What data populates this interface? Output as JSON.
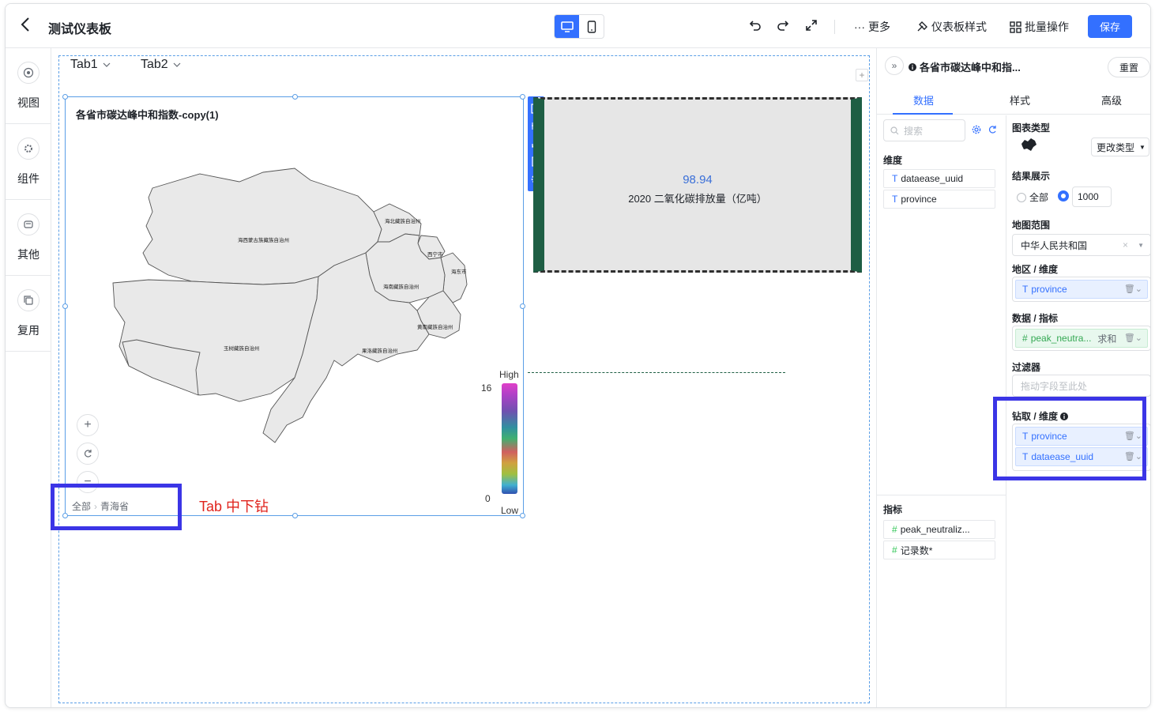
{
  "header": {
    "title": "测试仪表板",
    "more_label": "更多",
    "style_label": "仪表板样式",
    "batch_label": "批量操作",
    "save_label": "保存"
  },
  "sidebar": {
    "items": [
      {
        "label": "视图",
        "icon": "view-icon"
      },
      {
        "label": "组件",
        "icon": "component-icon"
      },
      {
        "label": "其他",
        "icon": "other-icon"
      },
      {
        "label": "复用",
        "icon": "reuse-icon"
      }
    ]
  },
  "canvas": {
    "tabs": [
      {
        "label": "Tab1"
      },
      {
        "label": "Tab2"
      }
    ],
    "map_chart": {
      "title": "各省市碳达峰中和指数-copy(1)",
      "regions": [
        "海西蒙古族藏族自治州",
        "海北藏族自治州",
        "西宁市",
        "海东市",
        "海南藏族自治州",
        "黄南藏族自治州",
        "玉树藏族自治州",
        "果洛藏族自治州"
      ],
      "legend_high": "High",
      "legend_low": "Low",
      "legend_max": "16",
      "legend_min": "0",
      "breadcrumb_root": "全部",
      "breadcrumb_current": "青海省"
    },
    "kpi_card": {
      "value": "98.94",
      "label": "2020 二氧化碳排放量（亿吨）"
    },
    "annotation": "Tab 中下钻"
  },
  "panel": {
    "chart_name": "各省市碳达峰中和指...",
    "reset_label": "重置",
    "tabs": [
      {
        "label": "数据"
      },
      {
        "label": "样式"
      },
      {
        "label": "高级"
      }
    ],
    "search_placeholder": "搜索",
    "dimension_header": "维度",
    "dimensions": [
      {
        "type": "T",
        "name": "dataease_uuid"
      },
      {
        "type": "T",
        "name": "province"
      }
    ],
    "metric_header": "指标",
    "metrics": [
      {
        "type": "#",
        "name": "peak_neutraliz..."
      },
      {
        "type": "#",
        "name": "记录数*"
      }
    ],
    "chart_type_label": "图表类型",
    "change_type_label": "更改类型",
    "result_label": "结果展示",
    "result_all": "全部",
    "result_count": "1000",
    "map_scope_label": "地图范围",
    "map_scope_value": "中华人民共和国",
    "area_label": "地区 / 维度",
    "area_field": "province",
    "data_label": "数据 / 指标",
    "data_field": "peak_neutra...",
    "data_agg": "求和",
    "filter_label": "过滤器",
    "filter_placeholder": "拖动字段至此处",
    "drill_label": "钻取 / 维度",
    "drill_fields": [
      {
        "name": "province"
      },
      {
        "name": "dataease_uuid"
      }
    ]
  },
  "colors": {
    "accent": "#3370ff",
    "annotation_box": "#3b35e6",
    "annotation_text": "#e0231c",
    "kpi_value": "#3a6fd8",
    "kpi_border": "#1e5e44"
  }
}
